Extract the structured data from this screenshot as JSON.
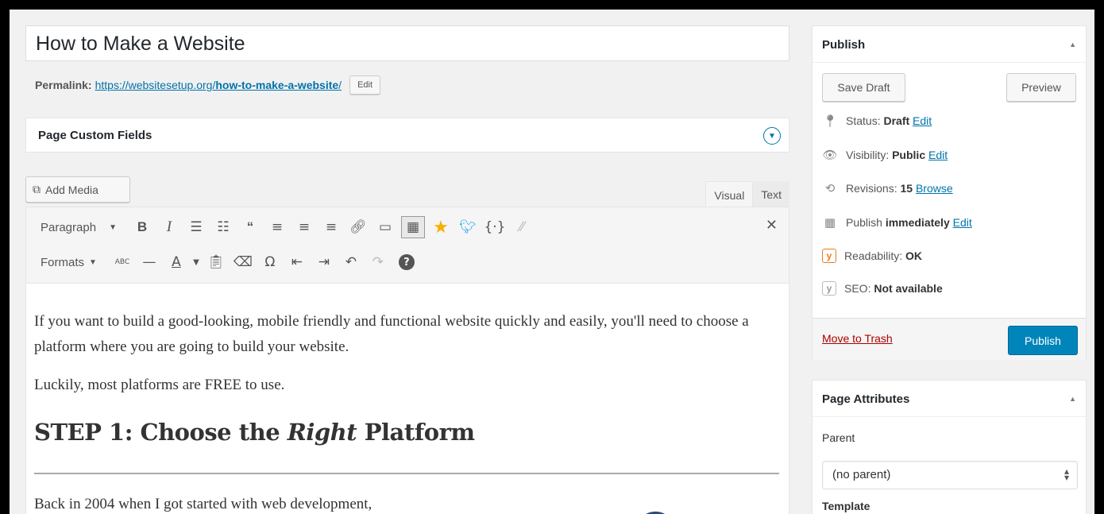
{
  "post": {
    "title": "How to Make a Website",
    "permalink_label": "Permalink:",
    "permalink_base": "https://websitesetup.org/",
    "permalink_slug": "how-to-make-a-website",
    "permalink_trail": "/",
    "edit_label": "Edit"
  },
  "custom_fields": {
    "title": "Page Custom Fields"
  },
  "editor": {
    "add_media_label": "Add Media",
    "tabs": [
      "Visual",
      "Text"
    ],
    "active_tab": "Visual",
    "paragraph_select": "Paragraph",
    "formats_select": "Formats",
    "content": {
      "p1": "If you want to build a good-looking, mobile friendly and functional website quickly and easily, you'll need to choose a platform where you are going to build your website.",
      "p2": "Luckily, most platforms are FREE to use.",
      "h2_start": "STEP 1: Choose the ",
      "h2_em": "Right",
      "h2_end": " Platform",
      "p3": "Back in 2004 when I got started with web development,"
    },
    "toolbar_icons": {
      "row1": [
        "bold-icon",
        "italic-icon",
        "bullet-list-icon",
        "numbered-list-icon",
        "blockquote-icon",
        "align-left-icon",
        "align-center-icon",
        "align-right-icon",
        "link-icon",
        "read-more-icon",
        "kitchen-sink-icon",
        "star-icon",
        "twitter-icon",
        "code-icon",
        "unlink-icon",
        "fullscreen-icon"
      ],
      "row2": [
        "strikethrough-icon",
        "horizontal-line-icon",
        "text-color-icon",
        "paste-text-icon",
        "clear-formatting-icon",
        "special-character-icon",
        "outdent-icon",
        "indent-icon",
        "undo-icon",
        "redo-icon",
        "help-icon"
      ]
    }
  },
  "publish": {
    "title": "Publish",
    "save_draft": "Save Draft",
    "preview": "Preview",
    "status_label": "Status:",
    "status_value": "Draft",
    "visibility_label": "Visibility:",
    "visibility_value": "Public",
    "revisions_label": "Revisions:",
    "revisions_value": "15",
    "browse": "Browse",
    "publish_label": "Publish",
    "publish_value": "immediately",
    "readability_label": "Readability:",
    "readability_value": "OK",
    "seo_label": "SEO:",
    "seo_value": "Not available",
    "edit": "Edit",
    "move_to_trash": "Move to Trash",
    "publish_button": "Publish",
    "colors": {
      "primary": "#0085ba",
      "trash": "#a00",
      "yoast_orange": "#ee7c1b"
    }
  },
  "page_attributes": {
    "title": "Page Attributes",
    "parent_label": "Parent",
    "parent_value": "(no parent)",
    "template_label": "Template"
  }
}
